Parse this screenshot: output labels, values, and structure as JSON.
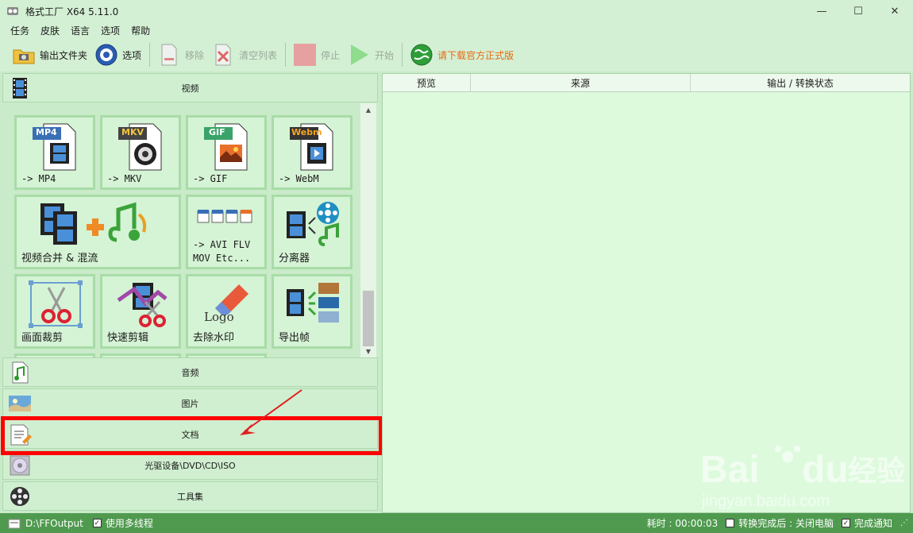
{
  "window": {
    "title": "格式工厂 X64 5.11.0",
    "minimize": "—",
    "maximize": "☐",
    "close": "✕"
  },
  "menu": [
    "任务",
    "皮肤",
    "语言",
    "选项",
    "帮助"
  ],
  "toolbar": {
    "output_folder": "输出文件夹",
    "options": "选项",
    "remove": "移除",
    "clear_list": "清空列表",
    "stop": "停止",
    "start": "开始",
    "download": "请下载官方正式版"
  },
  "categories": {
    "video": "视频",
    "audio": "音频",
    "image": "图片",
    "document": "文档",
    "disc": "光驱设备\\DVD\\CD\\ISO",
    "tools": "工具集"
  },
  "tiles": [
    {
      "label": "-> MP4",
      "badge": "MP4"
    },
    {
      "label": "-> MKV",
      "badge": "MKV"
    },
    {
      "label": "-> GIF",
      "badge": "GIF"
    },
    {
      "label": "-> WebM",
      "badge": "Webm"
    },
    {
      "label": "视频合并 & 混流"
    },
    {
      "label": "-> AVI FLV\nMOV Etc..."
    },
    {
      "label": "分离器"
    },
    {
      "label": "画面裁剪"
    },
    {
      "label": "快速剪辑"
    },
    {
      "label": "去除水印",
      "badge": "Logo"
    },
    {
      "label": "导出帧"
    }
  ],
  "table": {
    "columns": [
      "预览",
      "来源",
      "输出 / 转换状态"
    ]
  },
  "status": {
    "output_path": "D:\\FFOutput",
    "multithread": "使用多线程",
    "elapsed": "耗时 : 00:00:03",
    "after_convert": "转换完成后 : 关闭电脑",
    "notify": "完成通知"
  },
  "watermark": {
    "brand": "Bai",
    "brand2": "du",
    "cn": "经验",
    "url": "jingyan.baidu.com"
  }
}
